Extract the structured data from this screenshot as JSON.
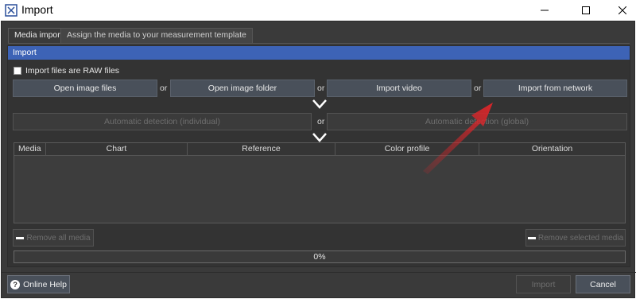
{
  "window": {
    "title": "Import",
    "minimize": "—",
    "maximize": "☐",
    "close": "✕"
  },
  "tabs": [
    {
      "label": "Media import"
    },
    {
      "label": "Assign the media to your measurement template"
    }
  ],
  "panel": {
    "header": "Import",
    "raw_checkbox_label": "Import files are RAW files",
    "raw_checked": false,
    "row1": {
      "open_image_files": "Open image files",
      "or1": "or",
      "open_image_folder": "Open image folder",
      "or2": "or",
      "import_video": "Import video",
      "or3": "or",
      "import_from_network": "Import from network"
    },
    "row2": {
      "auto_individual": "Automatic detection (individual)",
      "or": "or",
      "auto_global": "Automatic detection (global)"
    },
    "table": {
      "columns": [
        "Media",
        "Chart",
        "Reference",
        "Color profile",
        "Orientation"
      ],
      "rows": []
    },
    "remove_all": "Remove all media",
    "remove_selected": "Remove selected media",
    "progress": "0%"
  },
  "footer": {
    "online_help": "Online Help",
    "import": "Import",
    "cancel": "Cancel"
  },
  "colors": {
    "accent": "#3d63b6",
    "arrow": "#d8262a",
    "background": "#3a3a3a"
  }
}
